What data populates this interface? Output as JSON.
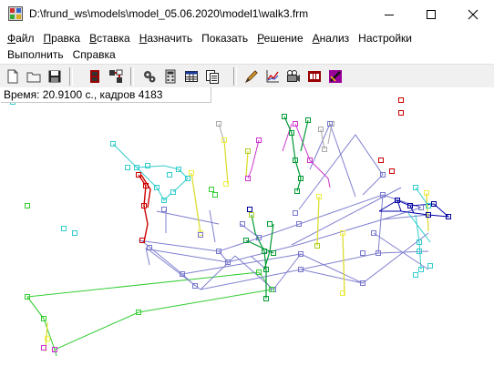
{
  "window": {
    "title": "D:\\frund_ws\\models\\model_05.06.2020\\model1\\walk3.frm"
  },
  "menu": {
    "row1": [
      {
        "label": "Файл",
        "accel": "Ф",
        "rest": "айл"
      },
      {
        "label": "Правка",
        "accel": "П",
        "rest": "равка"
      },
      {
        "label": "Вставка",
        "accel": "В",
        "rest": "ставка"
      },
      {
        "label": "Назначить",
        "accel": "Н",
        "rest": "азначить"
      },
      {
        "label": "Показать",
        "accel": "",
        "rest": "Показать"
      },
      {
        "label": "Решение",
        "accel": "Р",
        "rest": "ешение"
      },
      {
        "label": "Анализ",
        "accel": "А",
        "rest": "нализ"
      },
      {
        "label": "Настройки",
        "accel": "",
        "rest": "Настройки"
      }
    ],
    "row2": [
      {
        "label": "Выполнить",
        "accel": "",
        "rest": "Выполнить"
      },
      {
        "label": "Справка",
        "accel": "",
        "rest": "Справка"
      }
    ]
  },
  "toolbar": {
    "buttons": [
      {
        "name": "new-file-icon"
      },
      {
        "name": "open-folder-icon"
      },
      {
        "name": "save-icon"
      },
      {
        "name": "model-icon"
      },
      {
        "name": "structure-icon"
      },
      {
        "name": "gears-icon"
      },
      {
        "name": "calculator-icon"
      },
      {
        "name": "table-icon"
      },
      {
        "name": "pages-icon"
      },
      {
        "name": "pencil-icon"
      },
      {
        "name": "graph-icon"
      },
      {
        "name": "camera-icon"
      },
      {
        "name": "filmstrip-icon"
      },
      {
        "name": "animation-icon"
      }
    ]
  },
  "status": {
    "text": "Время:  20.9100 с., кадров 4183"
  },
  "scene": {
    "colors": {
      "frame": "#7777cc",
      "floor": "#33cc33",
      "red": "#cc0000",
      "cyan": "#33cccc",
      "yellow": "#eeee44",
      "magenta": "#cc33cc",
      "green": "#009933",
      "blue": "#000099",
      "grey": "#aaaaaa",
      "olive": "#aacc22"
    }
  }
}
